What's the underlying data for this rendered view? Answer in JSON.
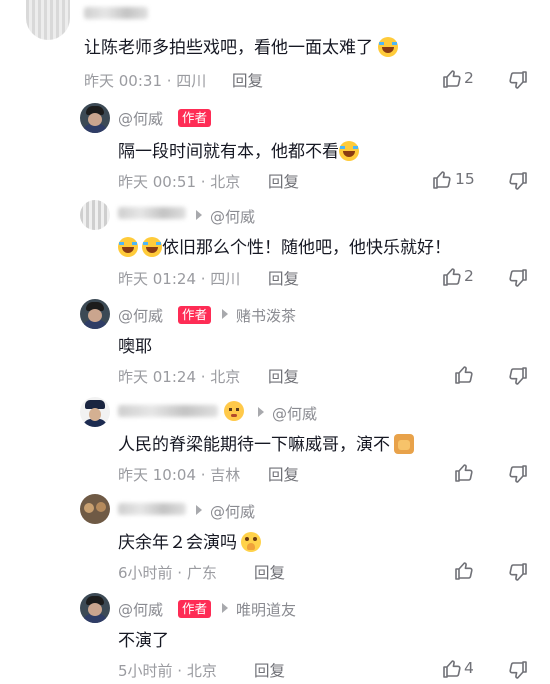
{
  "comments": [
    {
      "id": "c1",
      "username": "",
      "text": "让陈老师多拍些戏吧，看他一面太难了",
      "emoji": "laugh-cry",
      "time": "昨天 00:31 · 四川",
      "reply": "回复",
      "likes": "2"
    },
    {
      "id": "c2",
      "username": "@何威",
      "badge": "作者",
      "text": "隔一段时间就有本，他都不看",
      "emoji": "laugh-cry",
      "time": "昨天 00:51 · 北京",
      "reply": "回复",
      "likes": "15"
    },
    {
      "id": "c3",
      "username": "",
      "reply_to": "@何威",
      "text": "依旧那么个性！随他吧，他快乐就好！",
      "emoji_prefix": "laugh-cry x2",
      "time": "昨天 01:24 · 四川",
      "reply": "回复",
      "likes": "2"
    },
    {
      "id": "c4",
      "username": "@何威",
      "badge": "作者",
      "reply_to": "赌书泼茶",
      "text": "噢耶",
      "time": "昨天 01:24 · 北京",
      "reply": "回复",
      "likes": ""
    },
    {
      "id": "c5",
      "username": "",
      "reply_to": "@何威",
      "text": "人民的脊梁能期待一下嘛威哥，演不",
      "emoji": "cat-face",
      "time": "昨天 10:04 · 吉林",
      "reply": "回复",
      "likes": ""
    },
    {
      "id": "c6",
      "username": "",
      "reply_to": "@何威",
      "text": "庆余年２会演吗",
      "emoji": "pleading-face",
      "time": "6小时前 · 广东",
      "reply": "回复",
      "likes": ""
    },
    {
      "id": "c7",
      "username": "@何威",
      "badge": "作者",
      "reply_to": "唯明道友",
      "text": "不演了",
      "time": "5小时前 · 北京",
      "reply": "回复",
      "likes": "4"
    }
  ],
  "icons": {
    "like": "thumbs-up-icon",
    "dislike": "thumbs-down-icon",
    "arrow": "reply-arrow-icon"
  },
  "colors": {
    "badge": "#fe2c55",
    "text": "#161823",
    "meta": "#9a9ba0"
  }
}
